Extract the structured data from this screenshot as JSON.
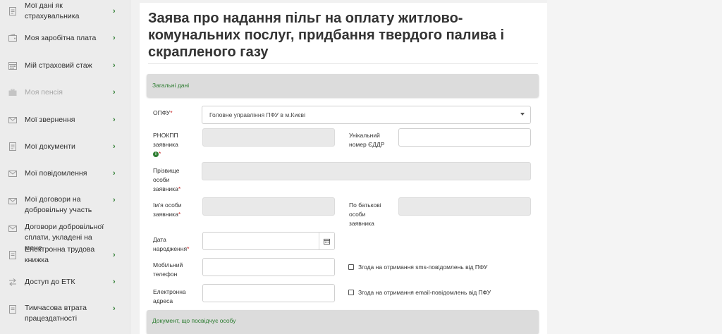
{
  "sidebar": {
    "items": [
      {
        "label": "Мої дані як страхувальника",
        "icon": "document-icon",
        "disabled": false
      },
      {
        "label": "Моя заробітна плата",
        "icon": "wallet-icon",
        "disabled": false
      },
      {
        "label": "Мій страховий стаж",
        "icon": "calendar-icon",
        "disabled": false
      },
      {
        "label": "Моя пенсія",
        "icon": "briefcase-icon",
        "disabled": true
      },
      {
        "label": "Мої звернення",
        "icon": "envelope-icon",
        "disabled": false
      },
      {
        "label": "Мої документи",
        "icon": "document-icon",
        "disabled": false
      },
      {
        "label": "Мої повідомлення",
        "icon": "envelope-icon",
        "disabled": false
      },
      {
        "label": "Мої договори на добровільну участь",
        "icon": "envelope-icon",
        "disabled": false
      },
      {
        "label": "Договори добровільної сплати, укладені на мене",
        "icon": "envelope-icon",
        "disabled": false
      },
      {
        "label": "Електронна трудова книжка",
        "icon": "document-icon",
        "disabled": false
      },
      {
        "label": "Доступ до ЕТК",
        "icon": "transfer-icon",
        "disabled": false
      },
      {
        "label": "Тимчасова втрата працездатності",
        "icon": "document-icon",
        "disabled": false
      }
    ],
    "chevron": "›"
  },
  "form": {
    "title": "Заява про надання пільг на оплату житлово-комунальних послуг, придбання твердого палива і скрапленого газу",
    "section_general": "Загальні дані",
    "section_document": "Документ, що посвідчує особу",
    "required_mark": "*",
    "info_mark": "i",
    "fields": {
      "opfu_label": "ОПФУ",
      "opfu_value": "Головне управління ПФУ в м.Києві",
      "rnokpp_label": "РНОКПП заявника",
      "unique_label": "Унікальний номер ЄДДР",
      "surname_label": "Прізвище особи заявника",
      "name_label": "Ім’я особи заявника",
      "patronymic_label": "По батькові особи заявника",
      "birth_label": "Дата народження",
      "phone_label": "Мобільний телефон",
      "email_label": "Електронна адреса",
      "sms_consent": "Згода на отримання sms-повідомлень від ПФУ",
      "email_consent": "Згода на отримання email-повідомлень від ПФУ"
    }
  }
}
